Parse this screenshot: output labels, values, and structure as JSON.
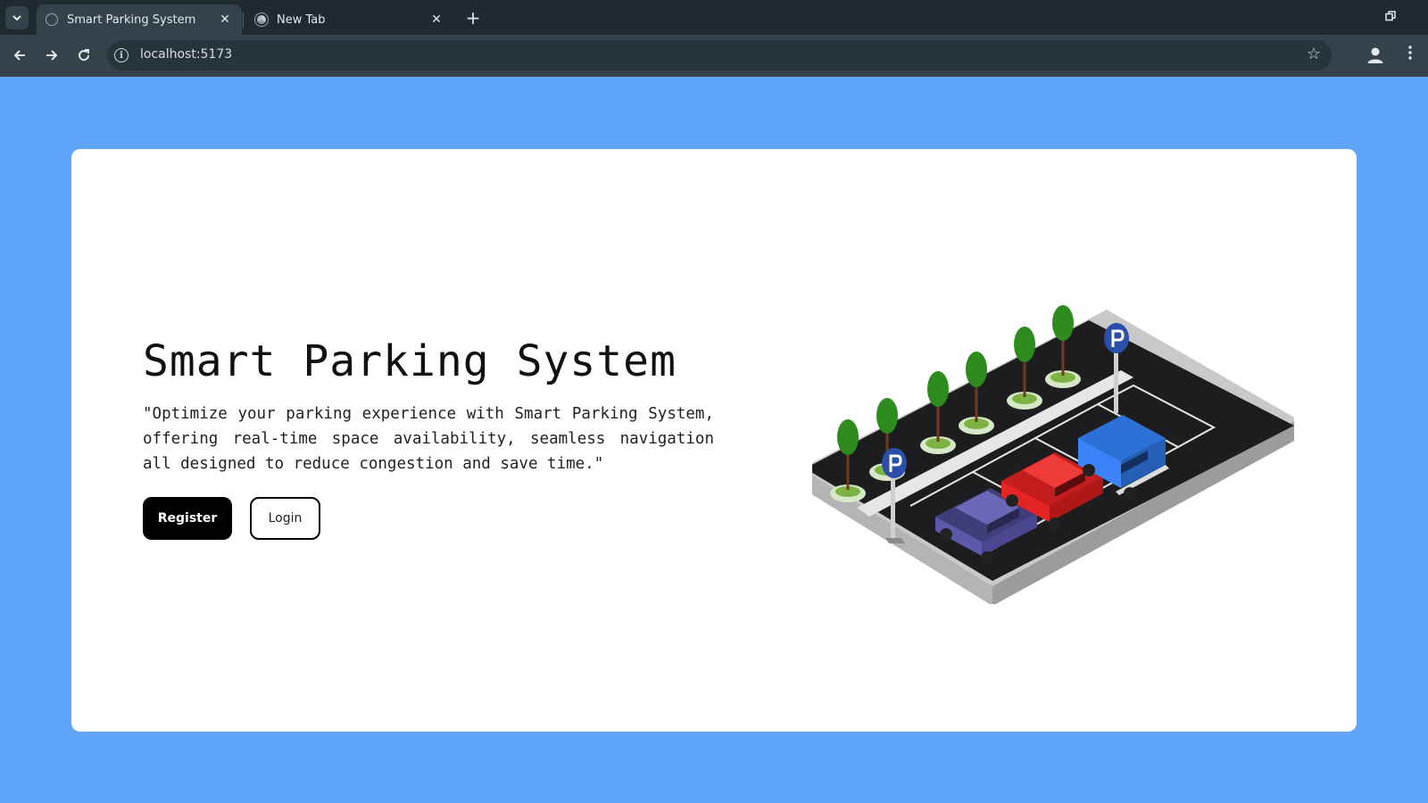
{
  "browser": {
    "tabs": [
      {
        "title": "Smart Parking System",
        "active": true
      },
      {
        "title": "New Tab",
        "active": false
      }
    ],
    "url": "localhost:5173",
    "icons": {
      "tab_list": "chevron-down-icon",
      "close": "close-icon",
      "new_tab": "plus-icon",
      "back": "arrow-left-icon",
      "forward": "arrow-right-icon",
      "reload": "reload-icon",
      "site_info": "info-icon",
      "bookmark": "star-icon",
      "profile": "person-icon",
      "menu": "more-vert-icon"
    }
  },
  "hero": {
    "title": "Smart Parking System",
    "description": "\"Optimize your parking experience with Smart Parking System, offering real-time space availability, seamless navigation all designed to reduce congestion and save time.\"",
    "register_label": "Register",
    "login_label": "Login"
  },
  "colors": {
    "page_background": "#60a5fa",
    "card_background": "#ffffff",
    "primary_button": "#000000",
    "browser_frame": "#1f2a30",
    "browser_toolbar": "#33424b"
  }
}
